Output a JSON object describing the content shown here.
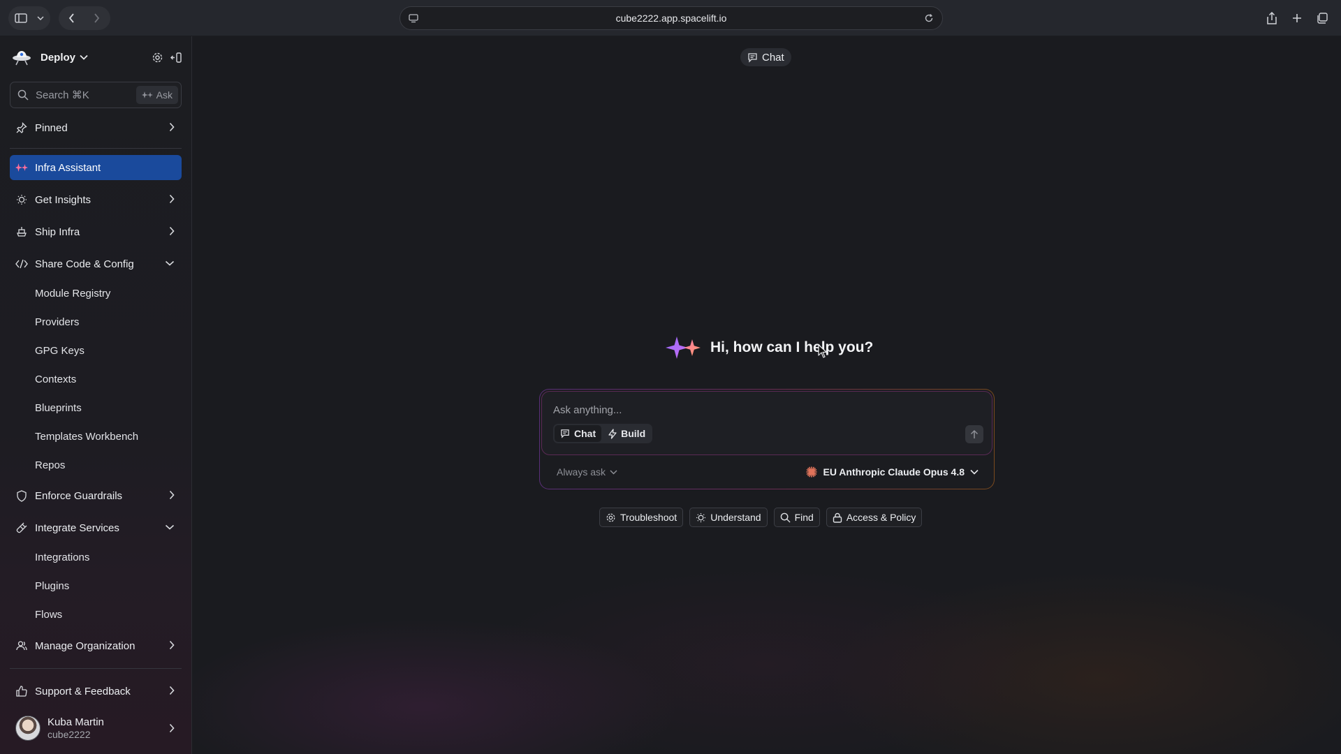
{
  "browser": {
    "url": "cube2222.app.spacelift.io"
  },
  "sidebar": {
    "org_name": "Deploy",
    "search_placeholder": "Search ⌘K",
    "ask_label": "Ask",
    "pinned_label": "Pinned",
    "items": [
      {
        "label": "Infra Assistant",
        "icon": "sparkle-icon",
        "active": true
      },
      {
        "label": "Get Insights",
        "icon": "lightbulb-icon"
      },
      {
        "label": "Ship Infra",
        "icon": "ship-icon"
      },
      {
        "label": "Share Code & Config",
        "icon": "code-icon",
        "expanded": true
      },
      {
        "label": "Enforce Guardrails",
        "icon": "shield-icon"
      },
      {
        "label": "Integrate Services",
        "icon": "plug-icon",
        "expanded": true
      },
      {
        "label": "Manage Organization",
        "icon": "users-icon"
      }
    ],
    "share_code_children": [
      "Module Registry",
      "Providers",
      "GPG Keys",
      "Contexts",
      "Blueprints",
      "Templates Workbench",
      "Repos"
    ],
    "integrate_children": [
      "Integrations",
      "Plugins",
      "Flows"
    ],
    "support_label": "Support & Feedback",
    "user": {
      "name": "Kuba Martin",
      "handle": "cube2222"
    }
  },
  "main": {
    "tab_label": "Chat",
    "greeting": "Hi, how can I help you?",
    "input_placeholder": "Ask anything...",
    "modes": [
      {
        "label": "Chat",
        "selected": true
      },
      {
        "label": "Build",
        "selected": false
      }
    ],
    "approval_label": "Always ask",
    "model_label": "EU Anthropic Claude Opus 4.8",
    "suggestions": [
      {
        "label": "Troubleshoot",
        "icon": "gear-icon"
      },
      {
        "label": "Understand",
        "icon": "lightbulb-icon"
      },
      {
        "label": "Find",
        "icon": "search-icon"
      },
      {
        "label": "Access & Policy",
        "icon": "lock-icon"
      }
    ]
  },
  "colors": {
    "accent_active": "#1a4a9c",
    "background": "#1a1b1f"
  }
}
